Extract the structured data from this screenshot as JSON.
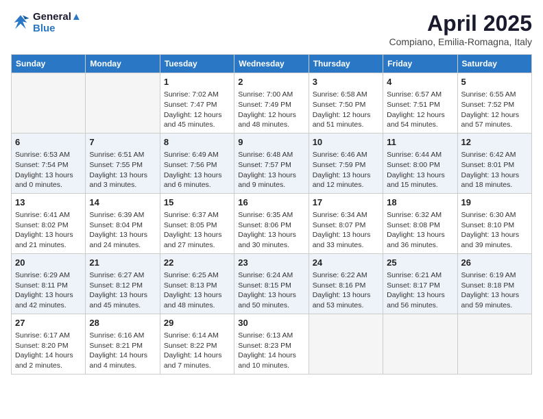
{
  "logo": {
    "line1": "General",
    "line2": "Blue"
  },
  "title": "April 2025",
  "subtitle": "Compiano, Emilia-Romagna, Italy",
  "days_header": [
    "Sunday",
    "Monday",
    "Tuesday",
    "Wednesday",
    "Thursday",
    "Friday",
    "Saturday"
  ],
  "weeks": [
    [
      {
        "num": "",
        "info": ""
      },
      {
        "num": "",
        "info": ""
      },
      {
        "num": "1",
        "info": "Sunrise: 7:02 AM\nSunset: 7:47 PM\nDaylight: 12 hours and 45 minutes."
      },
      {
        "num": "2",
        "info": "Sunrise: 7:00 AM\nSunset: 7:49 PM\nDaylight: 12 hours and 48 minutes."
      },
      {
        "num": "3",
        "info": "Sunrise: 6:58 AM\nSunset: 7:50 PM\nDaylight: 12 hours and 51 minutes."
      },
      {
        "num": "4",
        "info": "Sunrise: 6:57 AM\nSunset: 7:51 PM\nDaylight: 12 hours and 54 minutes."
      },
      {
        "num": "5",
        "info": "Sunrise: 6:55 AM\nSunset: 7:52 PM\nDaylight: 12 hours and 57 minutes."
      }
    ],
    [
      {
        "num": "6",
        "info": "Sunrise: 6:53 AM\nSunset: 7:54 PM\nDaylight: 13 hours and 0 minutes."
      },
      {
        "num": "7",
        "info": "Sunrise: 6:51 AM\nSunset: 7:55 PM\nDaylight: 13 hours and 3 minutes."
      },
      {
        "num": "8",
        "info": "Sunrise: 6:49 AM\nSunset: 7:56 PM\nDaylight: 13 hours and 6 minutes."
      },
      {
        "num": "9",
        "info": "Sunrise: 6:48 AM\nSunset: 7:57 PM\nDaylight: 13 hours and 9 minutes."
      },
      {
        "num": "10",
        "info": "Sunrise: 6:46 AM\nSunset: 7:59 PM\nDaylight: 13 hours and 12 minutes."
      },
      {
        "num": "11",
        "info": "Sunrise: 6:44 AM\nSunset: 8:00 PM\nDaylight: 13 hours and 15 minutes."
      },
      {
        "num": "12",
        "info": "Sunrise: 6:42 AM\nSunset: 8:01 PM\nDaylight: 13 hours and 18 minutes."
      }
    ],
    [
      {
        "num": "13",
        "info": "Sunrise: 6:41 AM\nSunset: 8:02 PM\nDaylight: 13 hours and 21 minutes."
      },
      {
        "num": "14",
        "info": "Sunrise: 6:39 AM\nSunset: 8:04 PM\nDaylight: 13 hours and 24 minutes."
      },
      {
        "num": "15",
        "info": "Sunrise: 6:37 AM\nSunset: 8:05 PM\nDaylight: 13 hours and 27 minutes."
      },
      {
        "num": "16",
        "info": "Sunrise: 6:35 AM\nSunset: 8:06 PM\nDaylight: 13 hours and 30 minutes."
      },
      {
        "num": "17",
        "info": "Sunrise: 6:34 AM\nSunset: 8:07 PM\nDaylight: 13 hours and 33 minutes."
      },
      {
        "num": "18",
        "info": "Sunrise: 6:32 AM\nSunset: 8:08 PM\nDaylight: 13 hours and 36 minutes."
      },
      {
        "num": "19",
        "info": "Sunrise: 6:30 AM\nSunset: 8:10 PM\nDaylight: 13 hours and 39 minutes."
      }
    ],
    [
      {
        "num": "20",
        "info": "Sunrise: 6:29 AM\nSunset: 8:11 PM\nDaylight: 13 hours and 42 minutes."
      },
      {
        "num": "21",
        "info": "Sunrise: 6:27 AM\nSunset: 8:12 PM\nDaylight: 13 hours and 45 minutes."
      },
      {
        "num": "22",
        "info": "Sunrise: 6:25 AM\nSunset: 8:13 PM\nDaylight: 13 hours and 48 minutes."
      },
      {
        "num": "23",
        "info": "Sunrise: 6:24 AM\nSunset: 8:15 PM\nDaylight: 13 hours and 50 minutes."
      },
      {
        "num": "24",
        "info": "Sunrise: 6:22 AM\nSunset: 8:16 PM\nDaylight: 13 hours and 53 minutes."
      },
      {
        "num": "25",
        "info": "Sunrise: 6:21 AM\nSunset: 8:17 PM\nDaylight: 13 hours and 56 minutes."
      },
      {
        "num": "26",
        "info": "Sunrise: 6:19 AM\nSunset: 8:18 PM\nDaylight: 13 hours and 59 minutes."
      }
    ],
    [
      {
        "num": "27",
        "info": "Sunrise: 6:17 AM\nSunset: 8:20 PM\nDaylight: 14 hours and 2 minutes."
      },
      {
        "num": "28",
        "info": "Sunrise: 6:16 AM\nSunset: 8:21 PM\nDaylight: 14 hours and 4 minutes."
      },
      {
        "num": "29",
        "info": "Sunrise: 6:14 AM\nSunset: 8:22 PM\nDaylight: 14 hours and 7 minutes."
      },
      {
        "num": "30",
        "info": "Sunrise: 6:13 AM\nSunset: 8:23 PM\nDaylight: 14 hours and 10 minutes."
      },
      {
        "num": "",
        "info": ""
      },
      {
        "num": "",
        "info": ""
      },
      {
        "num": "",
        "info": ""
      }
    ]
  ]
}
